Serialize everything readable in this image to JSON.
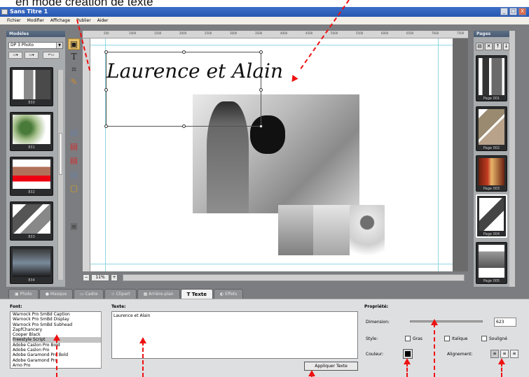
{
  "annotation": {
    "caption": "en mode création de texte"
  },
  "window": {
    "title": "Sans Titre 1",
    "min": "_",
    "max": "□",
    "close": "X"
  },
  "menu": [
    "Fichier",
    "Modifier",
    "Affichage",
    "Publier",
    "Aider"
  ],
  "left_panel": {
    "header": "Modèles",
    "select_value": "DP 3 Photo",
    "thumbnails": [
      "830",
      "831",
      "832",
      "833",
      "834"
    ]
  },
  "tools": [
    "photo-tool",
    "text-tool",
    "crop-tool",
    "clipart-tool"
  ],
  "canvas": {
    "text": "Laurence et Alain",
    "zoom": "11%",
    "ruler_marks": [
      "500",
      "1000",
      "1500",
      "2000",
      "2500",
      "3000",
      "3500",
      "4000",
      "4500",
      "5000",
      "5500",
      "6000",
      "6500",
      "7000",
      "7500"
    ]
  },
  "right_panel": {
    "header": "Pages",
    "pages": [
      "Page 001",
      "Page 002",
      "Page 003",
      "Page 004",
      "Page 005"
    ]
  },
  "tabs": [
    "Photo",
    "Masque",
    "Cadre",
    "Clipart",
    "Arrière-plan",
    "Texte",
    "Effets"
  ],
  "active_tab": "Texte",
  "font": {
    "label": "Font:",
    "items": [
      "Warnock Pro SmBd Caption",
      "Warnock Pro SmBd Display",
      "Warnock Pro SmBd Subhead",
      "ZapfChancery",
      "Cooper Black",
      "Freestyle Script",
      "Adobe Caslon Pro Bold",
      "Adobe Caslon Pro",
      "Adobe Garamond Pro Bold",
      "Adobe Garamond Pro",
      "Arno Pro"
    ],
    "selected": "Freestyle Script"
  },
  "texte": {
    "label": "Texte:",
    "value": "Laurence et Alain",
    "apply_label": "Appliquer Texte"
  },
  "props": {
    "label": "Propriété:",
    "dimension_label": "Dimension:",
    "dimension_value": "623",
    "style_label": "Style:",
    "gras": "Gras",
    "italique": "Italique",
    "souligne": "Souligné",
    "couleur_label": "Couleur:",
    "alignement_label": "Alignement:",
    "text_color": "#000000"
  }
}
